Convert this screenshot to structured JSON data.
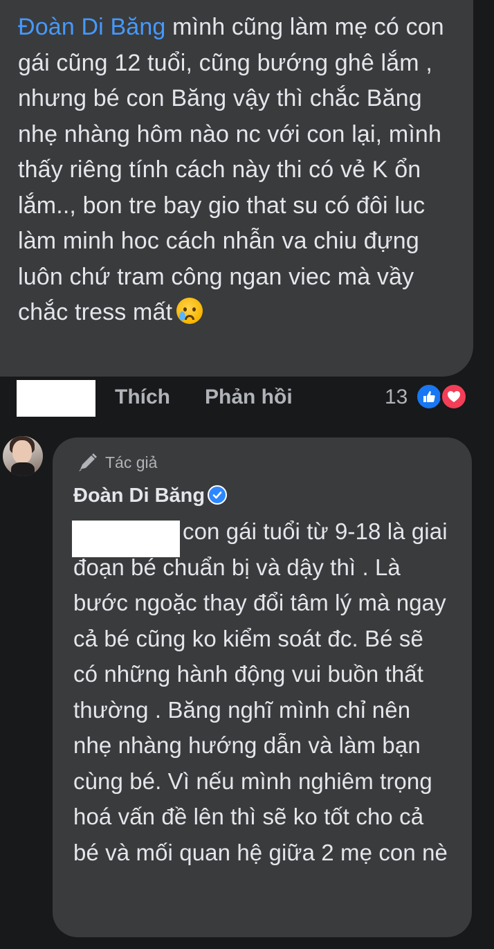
{
  "comment_top": {
    "mention": "Đoàn Di Băng",
    "text": " mình cũng làm mẹ có con gái cũng 12 tuổi, cũng bướng ghê lắm , nhưng bé con Băng vậy thì chắc Băng nhẹ nhàng hôm nào nc với con lại, mình thấy riêng tính cách này thi có vẻ K ổn lắm.., bon tre bay gio that su có đôi luc làm minh hoc cách nhẫn va chiu đựng luôn chứ tram công ngan viec mà vầy chắc tress mất",
    "emoji": "sad-but-relieved-emoji"
  },
  "actions": {
    "like_label": "Thích",
    "reply_label": "Phản hồi",
    "reaction_count": "13",
    "reaction_icons": [
      "like-reaction-icon",
      "love-reaction-icon"
    ],
    "like_color": "#1877f2",
    "love_color": "#f33e58"
  },
  "reply": {
    "badge_label": "Tác giả",
    "author_name": "Đoàn Di Băng",
    "verified": true,
    "text": "con gái tuổi từ 9-18 là giai đoạn bé chuẩn bị và dậy thì . Là bước ngoặc thay đổi tâm lý mà ngay cả bé cũng ko kiểm soát đc. Bé sẽ có những hành động vui buồn thất thường . Băng nghĩ mình chỉ nên nhẹ nhàng hướng dẫn và làm bạn cùng bé. Vì nếu mình nghiêm trọng hoá vấn đề lên thì sẽ ko tốt cho cả bé và mối quan hệ giữa 2 mẹ con nè"
  },
  "colors": {
    "background": "#18191a",
    "bubble": "#3a3b3c",
    "text": "#e4e6eb",
    "secondary_text": "#b0b3b8",
    "mention": "#4599ff"
  }
}
